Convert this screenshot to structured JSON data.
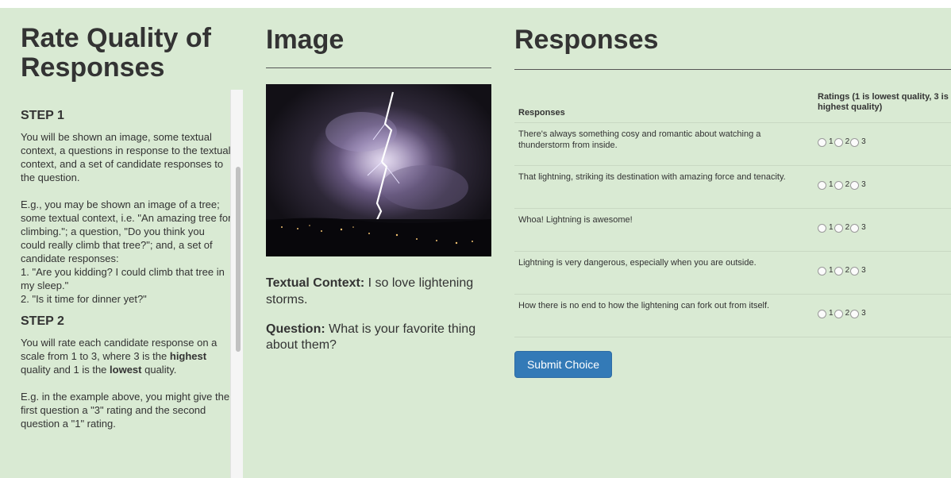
{
  "left": {
    "title": "Rate Quality of Responses",
    "step1": {
      "heading": "STEP 1",
      "para1": "You will be shown an image, some textual context, a questions in response to the textual context, and a set of candidate responses to the question.",
      "para2_lines": [
        "E.g., you may be shown an image of a tree; some textual context, i.e. \"An amazing tree for climbing.\"; a question, \"Do you think you could really climb that tree?\"; and, a set of candidate responses:",
        "1. \"Are you kidding? I could climb that tree in my sleep.\"",
        "2. \"Is it time for dinner yet?\""
      ]
    },
    "step2": {
      "heading": "STEP 2",
      "para1_pre": "You will rate each candidate response on a scale from 1 to 3, where 3 is the ",
      "para1_b1": "highest",
      "para1_mid": " quality and 1 is the ",
      "para1_b2": "lowest",
      "para1_post": " quality.",
      "para2": "E.g. in the example above, you might give the first question a \"3\" rating and the second question a \"1\" rating."
    }
  },
  "image": {
    "title": "Image",
    "context_label": "Textual Context:",
    "context_value": " I so love lightening storms.",
    "question_label": "Question:",
    "question_value": " What is your favorite thing about them?"
  },
  "responses": {
    "title": "Responses",
    "col_responses": "Responses",
    "col_ratings": "Ratings (1 is lowest quality, 3 is highest quality)",
    "rating_options": [
      "1",
      "2",
      "3"
    ],
    "rows": [
      "There's always something cosy and romantic about watching a thunderstorm from inside.",
      "That lightning, striking its destination with amazing force and tenacity.",
      "Whoa! Lightning is awesome!",
      "Lightning is very dangerous, especially when you are outside.",
      "How there is no end to how the lightening can fork out from itself."
    ],
    "submit_label": "Submit Choice"
  },
  "colors": {
    "page_background": "#d9ead3",
    "button_primary": "#337ab7"
  }
}
